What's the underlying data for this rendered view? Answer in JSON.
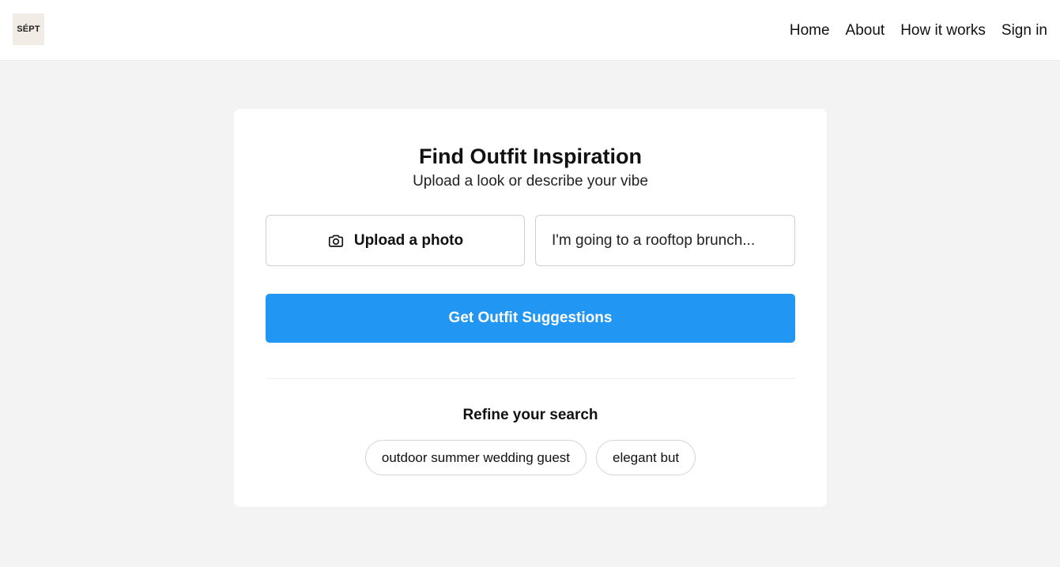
{
  "header": {
    "logo_text": "SÉPT",
    "nav": [
      {
        "label": "Home"
      },
      {
        "label": "About"
      },
      {
        "label": "How it works"
      },
      {
        "label": "Sign in"
      }
    ]
  },
  "main": {
    "title": "Find Outfit Inspiration",
    "subtitle": "Upload a look or describe your vibe",
    "upload": {
      "label": "Upload a photo",
      "icon": "camera-icon"
    },
    "vibe_input": {
      "placeholder": "I'm going to a rooftop brunch...",
      "value": ""
    },
    "submit_label": "Get Outfit Suggestions",
    "refine": {
      "title": "Refine your search",
      "chips": [
        {
          "label": "outdoor summer wedding guest"
        },
        {
          "label": "elegant but"
        }
      ]
    }
  },
  "colors": {
    "accent": "#2196f3",
    "page_background": "#f3f3f3",
    "card_background": "#ffffff",
    "logo_background": "#f1ede6"
  }
}
